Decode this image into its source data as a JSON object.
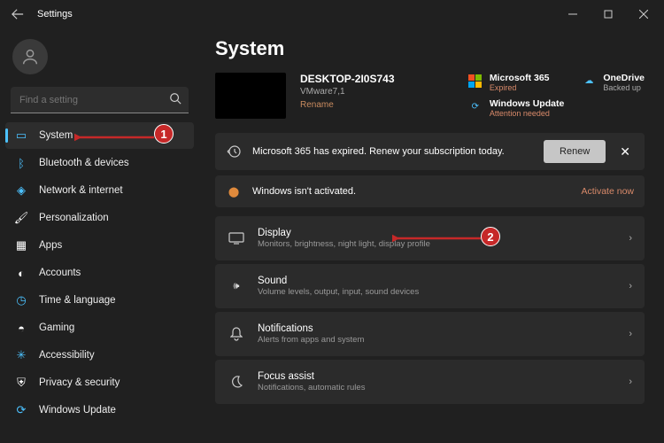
{
  "titlebar": {
    "title": "Settings"
  },
  "search": {
    "placeholder": "Find a setting"
  },
  "nav": [
    {
      "label": "System",
      "icon": "display-icon"
    },
    {
      "label": "Bluetooth & devices",
      "icon": "bluetooth-icon"
    },
    {
      "label": "Network & internet",
      "icon": "wifi-icon"
    },
    {
      "label": "Personalization",
      "icon": "brush-icon"
    },
    {
      "label": "Apps",
      "icon": "apps-icon"
    },
    {
      "label": "Accounts",
      "icon": "person-icon"
    },
    {
      "label": "Time & language",
      "icon": "clock-icon"
    },
    {
      "label": "Gaming",
      "icon": "game-icon"
    },
    {
      "label": "Accessibility",
      "icon": "accessibility-icon"
    },
    {
      "label": "Privacy & security",
      "icon": "shield-icon"
    },
    {
      "label": "Windows Update",
      "icon": "update-icon"
    }
  ],
  "page": {
    "title": "System",
    "device_name": "DESKTOP-2I0S743",
    "device_model": "VMware7,1",
    "rename": "Rename"
  },
  "status": {
    "ms365_title": "Microsoft 365",
    "ms365_sub": "Expired",
    "onedrive_title": "OneDrive",
    "onedrive_sub": "Backed up",
    "wu_title": "Windows Update",
    "wu_sub": "Attention needed"
  },
  "banner": {
    "text": "Microsoft 365 has expired. Renew your subscription today.",
    "renew": "Renew"
  },
  "warn": {
    "text": "Windows isn't activated.",
    "activate": "Activate now"
  },
  "rows": [
    {
      "title": "Display",
      "sub": "Monitors, brightness, night light, display profile"
    },
    {
      "title": "Sound",
      "sub": "Volume levels, output, input, sound devices"
    },
    {
      "title": "Notifications",
      "sub": "Alerts from apps and system"
    },
    {
      "title": "Focus assist",
      "sub": "Notifications, automatic rules"
    }
  ],
  "annotations": {
    "marker1": "1",
    "marker2": "2"
  }
}
